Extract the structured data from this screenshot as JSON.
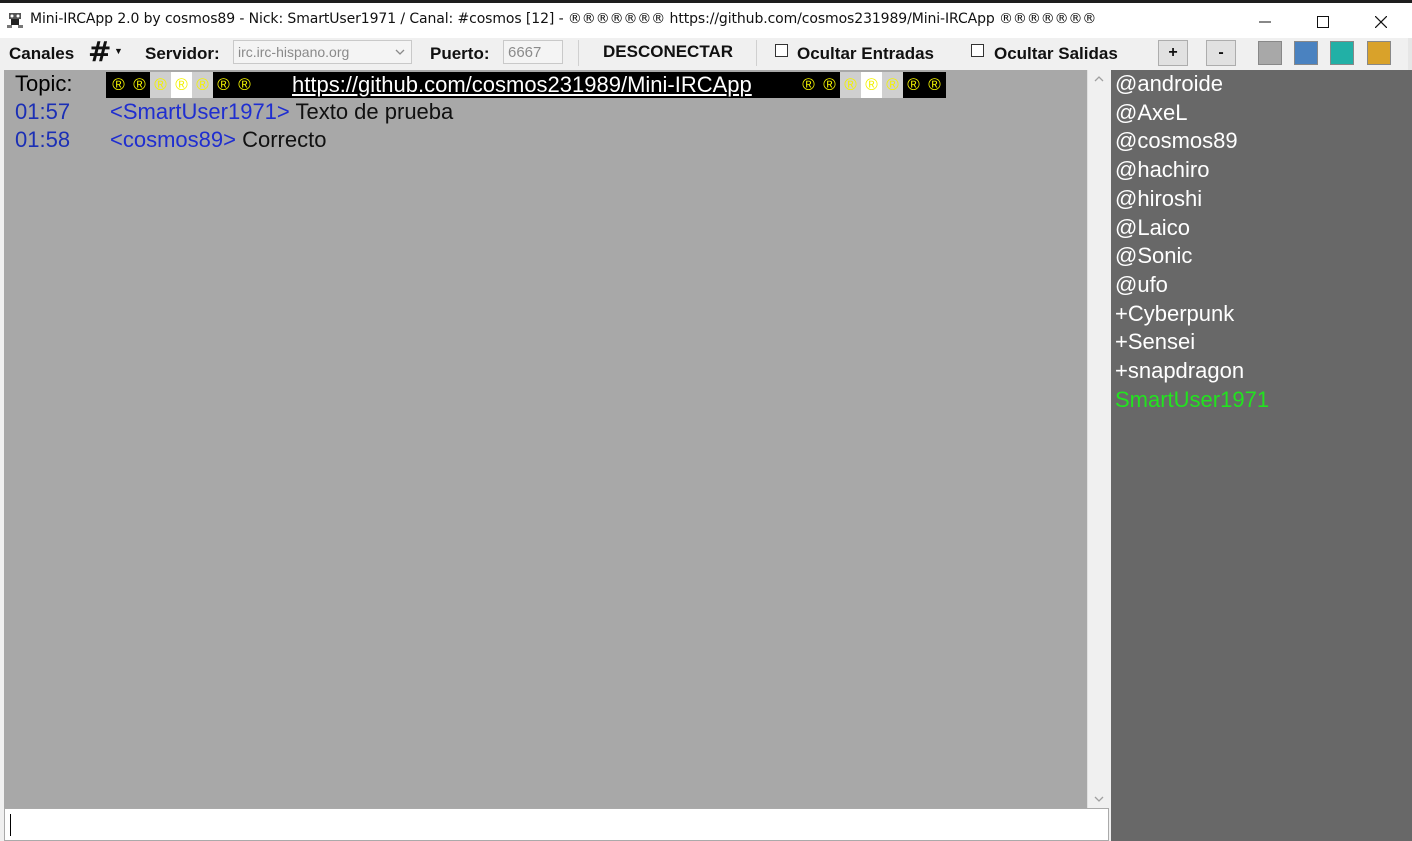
{
  "window": {
    "title": "Mini-IRCApp 2.0 by cosmos89 - Nick: SmartUser1971 / Canal: #cosmos [12]  - ®®®®®®®  https://github.com/cosmos231989/Mini-IRCApp ®®®®®®®"
  },
  "toolbar": {
    "canales_label": "Canales",
    "hash_glyph": "#",
    "servidor_label": "Servidor:",
    "server_value": "irc.irc-hispano.org",
    "puerto_label": "Puerto:",
    "port_value": "6667",
    "disconnect_label": "DESCONECTAR",
    "hide_joins_label": "Ocultar Entradas",
    "hide_parts_label": "Ocultar Salidas",
    "zoom_in_label": "+",
    "zoom_out_label": "-",
    "swatches": [
      "#a8a8a8",
      "#4a82c0",
      "#22b0a6",
      "#d9a22a"
    ]
  },
  "chat": {
    "topic_label": "Topic:",
    "topic_link": "https://github.com/cosmos231989/Mini-IRCApp",
    "topic_symbol": "®",
    "messages": [
      {
        "time": "01:57",
        "nick": "<SmartUser1971>",
        "text": "Texto de prueba"
      },
      {
        "time": "01:58",
        "nick": "<cosmos89>",
        "text": "Correcto"
      }
    ]
  },
  "users": [
    "@androide",
    "@AxeL",
    "@cosmos89",
    "@hachiro",
    "@hiroshi",
    "@Laico",
    "@Sonic",
    "@ufo",
    "+Cyberpunk",
    "+Sensei",
    "+snapdragon",
    "SmartUser1971"
  ],
  "colors": {
    "chat_bg": "#a8a8a8",
    "nicklist_bg": "#686868",
    "self_nick": "#22e31f",
    "timestamp": "#1b2fb5",
    "topic_symbol_yellow": "#f2f200"
  }
}
